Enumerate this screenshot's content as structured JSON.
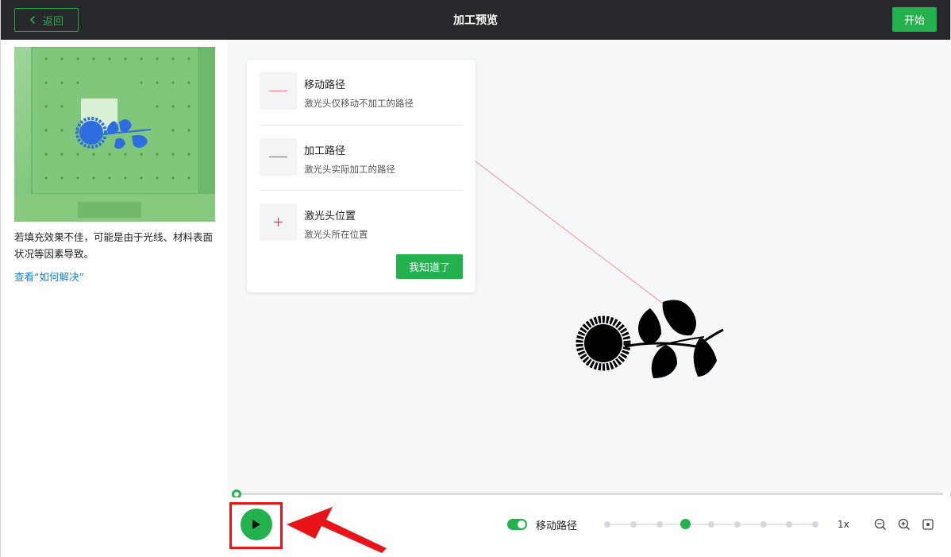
{
  "header": {
    "back_label": "返回",
    "title": "加工预览",
    "start_label": "开始"
  },
  "left_panel": {
    "hint_text": "若填充效果不佳，可能是由于光线、材料表面状况等因素导致。",
    "solve_link": "查看“如何解决”"
  },
  "legend": {
    "items": [
      {
        "title": "移动路径",
        "desc": "激光头仅移动不加工的路径",
        "icon": "move-path-line-icon",
        "color": "#f08a8a"
      },
      {
        "title": "加工路径",
        "desc": "激光头实际加工的路径",
        "icon": "process-path-line-icon",
        "color": "#888888"
      },
      {
        "title": "激光头位置",
        "desc": "激光头所在位置",
        "icon": "laser-crosshair-icon",
        "color": "#e8353a"
      }
    ],
    "ack_label": "我知道了"
  },
  "playback": {
    "progress": 0,
    "move_path_toggle_label": "移动路径",
    "move_path_toggle_on": true,
    "speed_steps": 9,
    "speed_active_index": 3,
    "speed_label": "1x"
  },
  "colors": {
    "accent": "#22b14c",
    "topbar": "#27282c",
    "link": "#1e7ec8",
    "highlight": "#e8141a"
  }
}
